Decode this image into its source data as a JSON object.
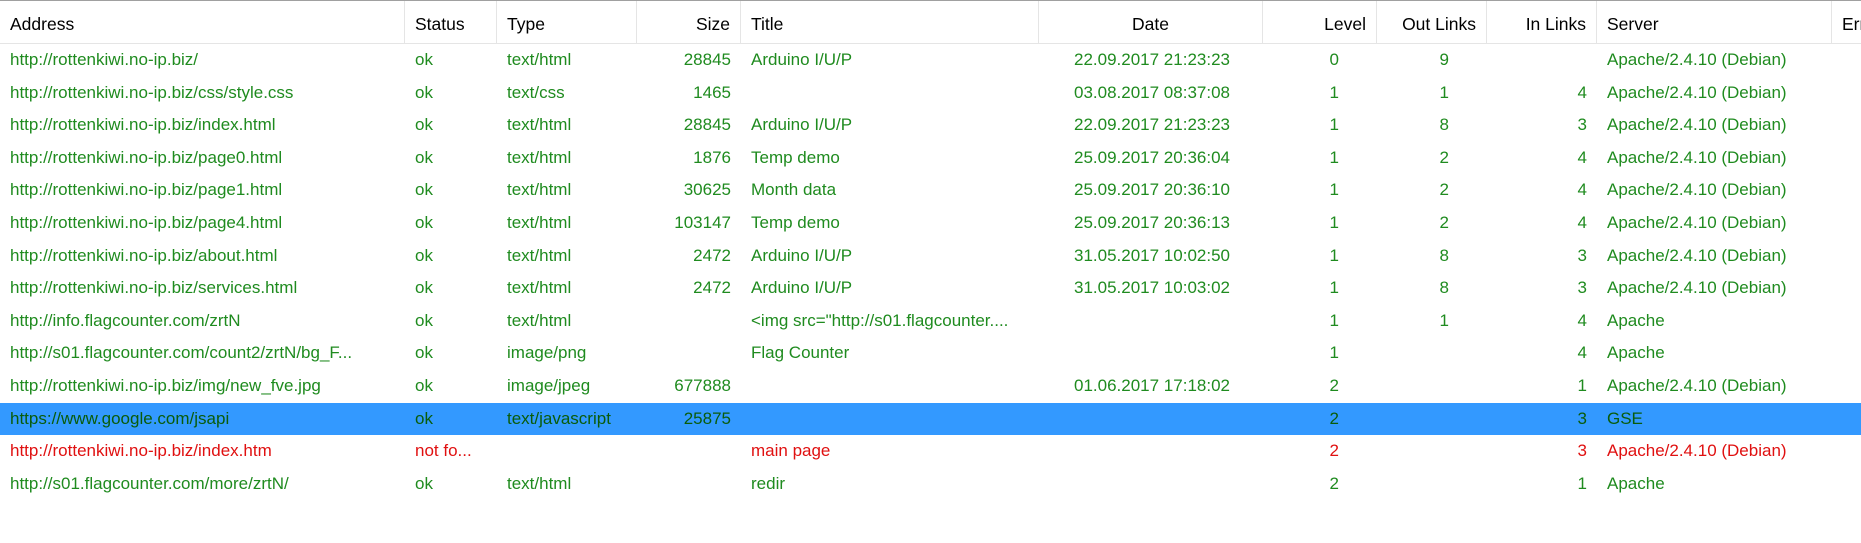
{
  "columns": {
    "address": "Address",
    "status": "Status",
    "type": "Type",
    "size": "Size",
    "title": "Title",
    "date": "Date",
    "level": "Level",
    "out_links": "Out Links",
    "in_links": "In Links",
    "server": "Server",
    "error": "Erro"
  },
  "colors": {
    "ok_text": "#1f8b1f",
    "broken_text": "#e01010",
    "selection": "#3399ff"
  },
  "rows": [
    {
      "address": "http://rottenkiwi.no-ip.biz/",
      "status": "ok",
      "type": "text/html",
      "size": "28845",
      "title": "Arduino I/U/P",
      "date": "22.09.2017  21:23:23",
      "level": "0",
      "out_links": "9",
      "in_links": "",
      "server": "Apache/2.4.10 (Debian)"
    },
    {
      "address": "http://rottenkiwi.no-ip.biz/css/style.css",
      "status": "ok",
      "type": "text/css",
      "size": "1465",
      "title": "",
      "date": "03.08.2017  08:37:08",
      "level": "1",
      "out_links": "1",
      "in_links": "4",
      "server": "Apache/2.4.10 (Debian)"
    },
    {
      "address": "http://rottenkiwi.no-ip.biz/index.html",
      "status": "ok",
      "type": "text/html",
      "size": "28845",
      "title": "Arduino I/U/P",
      "date": "22.09.2017  21:23:23",
      "level": "1",
      "out_links": "8",
      "in_links": "3",
      "server": "Apache/2.4.10 (Debian)"
    },
    {
      "address": "http://rottenkiwi.no-ip.biz/page0.html",
      "status": "ok",
      "type": "text/html",
      "size": "1876",
      "title": "Temp demo",
      "date": "25.09.2017  20:36:04",
      "level": "1",
      "out_links": "2",
      "in_links": "4",
      "server": "Apache/2.4.10 (Debian)"
    },
    {
      "address": "http://rottenkiwi.no-ip.biz/page1.html",
      "status": "ok",
      "type": "text/html",
      "size": "30625",
      "title": "Month data",
      "date": "25.09.2017  20:36:10",
      "level": "1",
      "out_links": "2",
      "in_links": "4",
      "server": "Apache/2.4.10 (Debian)"
    },
    {
      "address": "http://rottenkiwi.no-ip.biz/page4.html",
      "status": "ok",
      "type": "text/html",
      "size": "103147",
      "title": "Temp demo",
      "date": "25.09.2017  20:36:13",
      "level": "1",
      "out_links": "2",
      "in_links": "4",
      "server": "Apache/2.4.10 (Debian)"
    },
    {
      "address": "http://rottenkiwi.no-ip.biz/about.html",
      "status": "ok",
      "type": "text/html",
      "size": "2472",
      "title": "Arduino I/U/P",
      "date": "31.05.2017  10:02:50",
      "level": "1",
      "out_links": "8",
      "in_links": "3",
      "server": "Apache/2.4.10 (Debian)"
    },
    {
      "address": "http://rottenkiwi.no-ip.biz/services.html",
      "status": "ok",
      "type": "text/html",
      "size": "2472",
      "title": "Arduino I/U/P",
      "date": "31.05.2017  10:03:02",
      "level": "1",
      "out_links": "8",
      "in_links": "3",
      "server": "Apache/2.4.10 (Debian)"
    },
    {
      "address": "http://info.flagcounter.com/zrtN",
      "status": "ok",
      "type": "text/html",
      "size": "",
      "title": "<img src=\"http://s01.flagcounter....",
      "date": "",
      "level": "1",
      "out_links": "1",
      "in_links": "4",
      "server": "Apache"
    },
    {
      "address": "http://s01.flagcounter.com/count2/zrtN/bg_F...",
      "status": "ok",
      "type": "image/png",
      "size": "",
      "title": "Flag Counter",
      "date": "",
      "level": "1",
      "out_links": "",
      "in_links": "4",
      "server": "Apache"
    },
    {
      "address": "http://rottenkiwi.no-ip.biz/img/new_fve.jpg",
      "status": "ok",
      "type": "image/jpeg",
      "size": "677888",
      "title": "",
      "date": "01.06.2017  17:18:02",
      "level": "2",
      "out_links": "",
      "in_links": "1",
      "server": "Apache/2.4.10 (Debian)"
    },
    {
      "address": "https://www.google.com/jsapi",
      "status": "ok",
      "type": "text/javascript",
      "size": "25875",
      "title": "",
      "date": "",
      "level": "2",
      "out_links": "",
      "in_links": "3",
      "server": "GSE",
      "selected": true
    },
    {
      "address": "http://rottenkiwi.no-ip.biz/index.htm",
      "status": "not fo...",
      "type": "",
      "size": "",
      "title": "main page",
      "date": "",
      "level": "2",
      "out_links": "",
      "in_links": "3",
      "server": "Apache/2.4.10 (Debian)",
      "broken": true
    },
    {
      "address": "http://s01.flagcounter.com/more/zrtN/",
      "status": "ok",
      "type": "text/html",
      "size": "",
      "title": "redir",
      "date": "",
      "level": "2",
      "out_links": "",
      "in_links": "1",
      "server": "Apache"
    }
  ]
}
